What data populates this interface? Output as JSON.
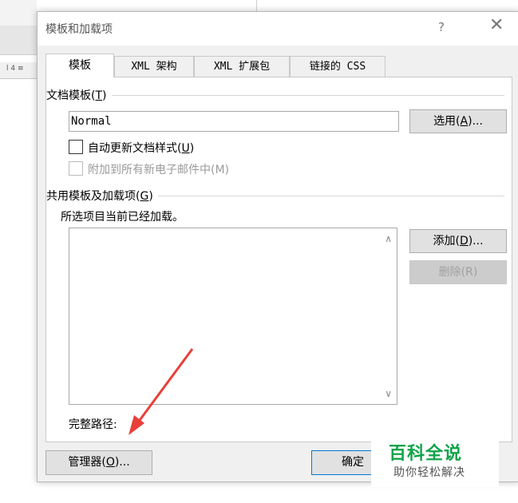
{
  "dialog": {
    "title": "模板和加载项",
    "help": "?",
    "close": "✕"
  },
  "tabs": [
    "模板",
    "XML 架构",
    "XML 扩展包",
    "链接的 CSS"
  ],
  "template_section": {
    "label": "文档模板(",
    "label_key": "T",
    "label_end": ")",
    "value": "Normal",
    "select_button": {
      "prefix": "选用(",
      "key": "A",
      "suffix": ")..."
    },
    "auto_update": {
      "prefix": "自动更新文档样式(",
      "key": "U",
      "suffix": ")"
    },
    "attach_email": "附加到所有新电子邮件中(M)"
  },
  "addins_section": {
    "label": "共用模板及加载项(",
    "label_key": "G",
    "label_end": ")",
    "status": "所选项目当前已经加载。",
    "add_button": {
      "prefix": "添加(",
      "key": "D",
      "suffix": ")..."
    },
    "remove_button": "删除(R)",
    "full_path": "完整路径:"
  },
  "footer": {
    "organizer_button": {
      "prefix": "管理器(",
      "key": "O",
      "suffix": ")..."
    },
    "ok_button": "确定"
  },
  "watermark": {
    "title": "百科全说",
    "subtitle": "助你轻松解决"
  },
  "background": {
    "ruler_mark": "l 4 ≡"
  }
}
